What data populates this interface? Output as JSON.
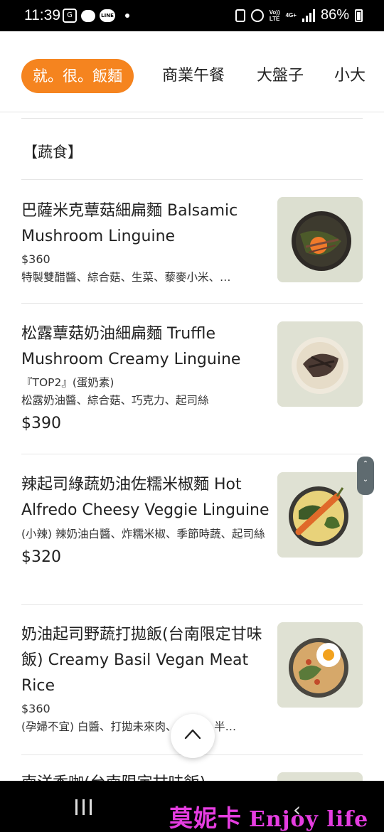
{
  "status_bar": {
    "time": "11:39",
    "left_icons": [
      "gmail-icon",
      "chat-bubble-icon",
      "line-icon",
      "dot-icon"
    ],
    "line_label": "LINE",
    "network_top": "Vo))",
    "network_bottom": "LTE",
    "network_type": "4G+",
    "battery": "86%"
  },
  "tabs": [
    {
      "label": "就。很。飯麵",
      "active": true
    },
    {
      "label": "商業午餐"
    },
    {
      "label": "大盤子"
    },
    {
      "label": "小大"
    }
  ],
  "section": {
    "title": "【蔬食】"
  },
  "items": [
    {
      "name": "巴薩米克蕈菇細扁麵 Balsamic Mushroom Linguine",
      "price": "$360",
      "desc": "特製雙醋醬、綜合菇、生菜、藜麥小米、…"
    },
    {
      "name": "松露蕈菇奶油細扁麵 Truffle Mushroom Creamy Linguine",
      "note": "『TOP2』(蛋奶素)",
      "desc": "松露奶油醬、綜合菇、巧克力、起司絲",
      "price": "$390"
    },
    {
      "name": "辣起司綠蔬奶油佐糯米椒麵 Hot Alfredo Cheesy Veggie Linguine",
      "desc": "(小辣) 辣奶油白醬、炸糯米椒、季節時蔬、起司絲",
      "price": "$320"
    },
    {
      "name": "奶油起司野蔬打拋飯(台南限定甘味飯) Creamy Basil Vegan Meat Rice",
      "price": "$360",
      "desc": "(孕婦不宜) 白醬、打拋未來肉、堅果)、半…"
    },
    {
      "name": "南洋香咖(台南限定甘味飯)"
    }
  ],
  "scroll_handle": {
    "up": "⌃",
    "down": "⌄"
  },
  "watermark": {
    "cn": "莫妮卡",
    "en": "Enjoy life"
  }
}
